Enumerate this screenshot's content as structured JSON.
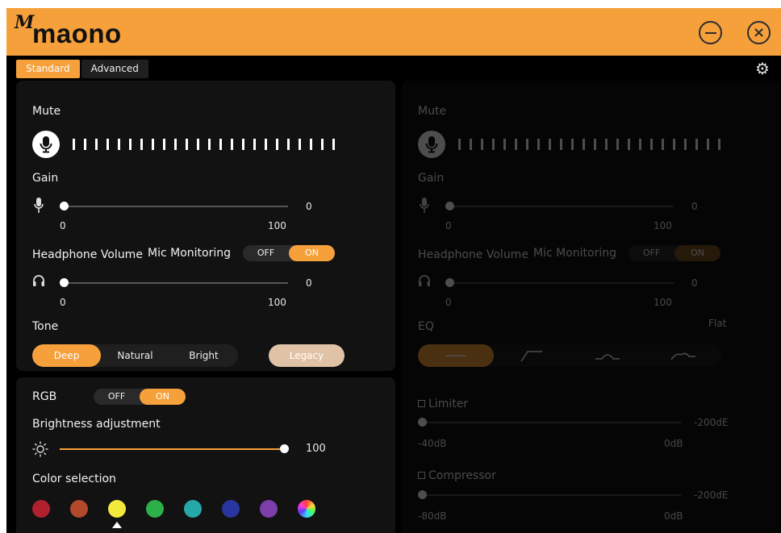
{
  "app": {
    "logo_mark": "M",
    "logo_text": "maono"
  },
  "window": {
    "minimize_icon": "minus-circle-icon",
    "close_icon": "x-circle-icon",
    "close_glyph": "×"
  },
  "tabs": [
    {
      "label": "Standard",
      "active": true
    },
    {
      "label": "Advanced",
      "active": false
    }
  ],
  "settings_icon": "gear-icon",
  "settings_glyph": "⚙",
  "left": {
    "mute_label": "Mute",
    "gain": {
      "label": "Gain",
      "value": "0",
      "min": "0",
      "max": "100"
    },
    "headphone": {
      "label": "Headphone Volume",
      "value": "0",
      "min": "0",
      "max": "100"
    },
    "mic_monitoring": {
      "label": "Mic Monitoring",
      "off": "OFF",
      "on": "ON",
      "state": "on"
    },
    "tone": {
      "label": "Tone",
      "options": [
        "Deep",
        "Natural",
        "Bright"
      ],
      "selected": "Deep",
      "legacy": "Legacy"
    }
  },
  "rgb": {
    "label": "RGB",
    "off": "OFF",
    "on": "ON",
    "state": "on",
    "brightness": {
      "label": "Brightness adjustment",
      "value": "100",
      "fraction": 1.0
    },
    "color_label": "Color selection",
    "colors": [
      "#b0202e",
      "#b2492c",
      "#f3e83c",
      "#2cb04a",
      "#27a8a8",
      "#2936a0",
      "#7c3ea8",
      "rainbow"
    ],
    "selected_index": 2
  },
  "right": {
    "mute_label": "Mute",
    "gain": {
      "label": "Gain",
      "value": "0",
      "min": "0",
      "max": "100"
    },
    "headphone": {
      "label": "Headphone Volume",
      "value": "0",
      "min": "0",
      "max": "100"
    },
    "mic_monitoring": {
      "label": "Mic Monitoring",
      "off": "OFF",
      "on": "ON"
    },
    "eq": {
      "label": "EQ",
      "preset": "Flat"
    },
    "limiter": {
      "label": "Limiter",
      "value": "-200dE",
      "min": "-40dB",
      "max": "0dB"
    },
    "compressor": {
      "label": "Compressor",
      "value": "-200dE",
      "min": "-80dB",
      "max": "0dB"
    }
  },
  "colors": {
    "accent": "#f6a03b",
    "panel": "#121212",
    "background": "#000000"
  }
}
